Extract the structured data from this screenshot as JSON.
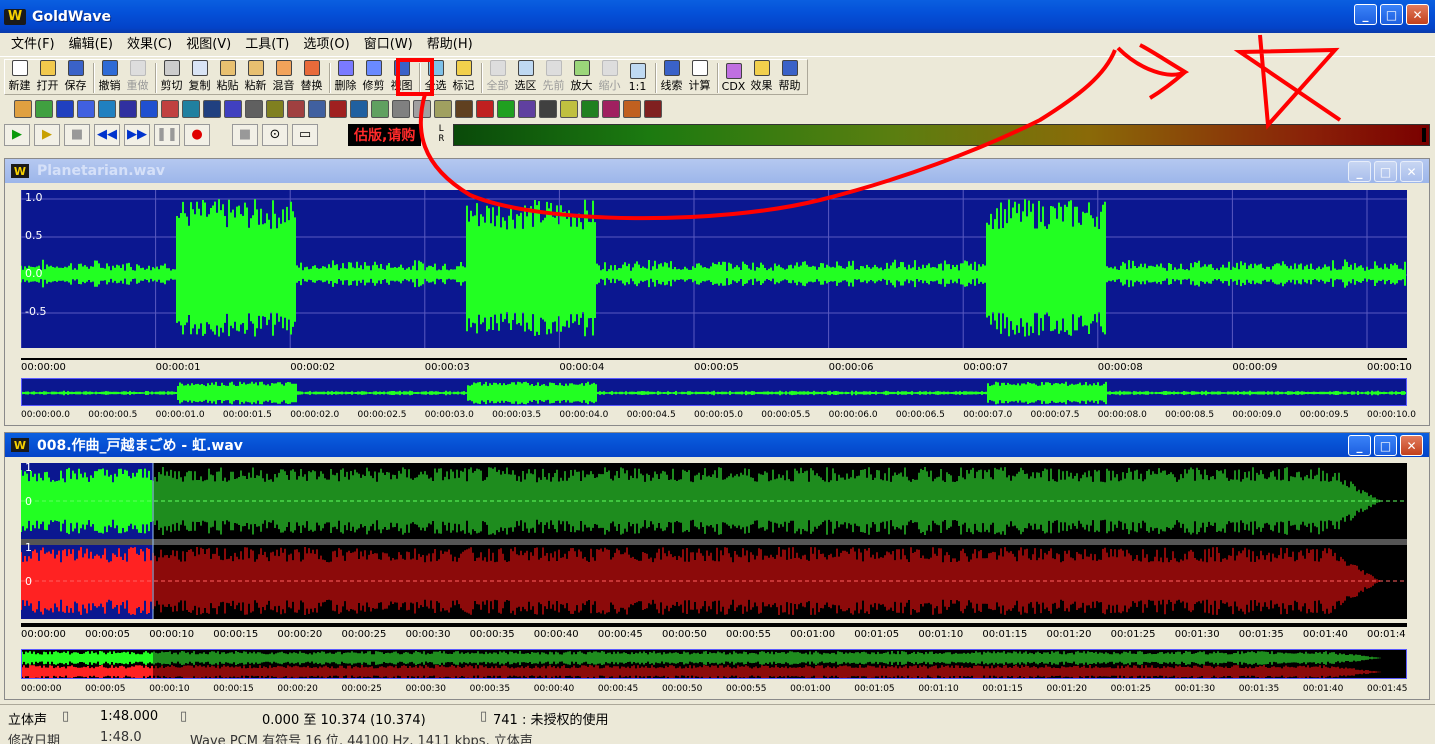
{
  "app": {
    "title": "GoldWave",
    "logo": "W"
  },
  "menu": [
    "文件(F)",
    "编辑(E)",
    "效果(C)",
    "视图(V)",
    "工具(T)",
    "选项(O)",
    "窗口(W)",
    "帮助(H)"
  ],
  "toolbar": [
    {
      "label": "新建",
      "icon": "new-file-icon",
      "color": "#FFFFFF"
    },
    {
      "label": "打开",
      "icon": "open-folder-icon",
      "color": "#F2C94C"
    },
    {
      "label": "保存",
      "icon": "save-disk-icon",
      "color": "#3A62C8"
    },
    {
      "label": "撤销",
      "icon": "undo-icon",
      "color": "#2E6BD6"
    },
    {
      "label": "重做",
      "icon": "redo-icon",
      "color": "#DDDDDD",
      "disabled": true
    },
    {
      "label": "剪切",
      "icon": "scissors-icon",
      "color": "#CCCCCC"
    },
    {
      "label": "复制",
      "icon": "copy-icon",
      "color": "#D9E4F5"
    },
    {
      "label": "粘贴",
      "icon": "paste-icon",
      "color": "#E8C070"
    },
    {
      "label": "粘新",
      "icon": "paste-new-icon",
      "color": "#E8C070"
    },
    {
      "label": "混音",
      "icon": "mix-icon",
      "color": "#F2A35A"
    },
    {
      "label": "替换",
      "icon": "replace-icon",
      "color": "#E86A3A"
    },
    {
      "label": "删除",
      "icon": "delete-icon",
      "color": "#7A7AFF"
    },
    {
      "label": "修剪",
      "icon": "trim-icon",
      "color": "#6A8AFF"
    },
    {
      "label": "视图",
      "icon": "view-icon",
      "color": "#3A62C8"
    },
    {
      "label": "全选",
      "icon": "select-all-icon",
      "color": "#7FC1E8"
    },
    {
      "label": "标记",
      "icon": "marker-icon",
      "color": "#F2D04C"
    },
    {
      "label": "全部",
      "icon": "zoom-all-icon",
      "color": "#DDDDDD",
      "disabled": true
    },
    {
      "label": "选区",
      "icon": "zoom-selection-icon",
      "color": "#BFD9F2"
    },
    {
      "label": "先前",
      "icon": "zoom-previous-icon",
      "color": "#DDDDDD",
      "disabled": true
    },
    {
      "label": "放大",
      "icon": "zoom-in-icon",
      "color": "#9BD67A"
    },
    {
      "label": "缩小",
      "icon": "zoom-out-icon",
      "color": "#DDDDDD",
      "disabled": true
    },
    {
      "label": "1:1",
      "icon": "zoom-1to1-icon",
      "color": "#BFD9F2"
    },
    {
      "label": "线索",
      "icon": "cue-icon",
      "color": "#3A62C8"
    },
    {
      "label": "计算",
      "icon": "calculator-icon",
      "color": "#FFFFFF"
    },
    {
      "label": "CDX",
      "icon": "cd-icon",
      "color": "#C070E0"
    },
    {
      "label": "效果",
      "icon": "effects-icon",
      "color": "#F2D04C"
    },
    {
      "label": "帮助",
      "icon": "help-icon",
      "color": "#3A62C8"
    }
  ],
  "effects_bar_colors": [
    "#E0A040",
    "#40A040",
    "#2040C0",
    "#4060E0",
    "#2080C0",
    "#3030A0",
    "#2050D0",
    "#C04040",
    "#2080A0",
    "#204080",
    "#4040C0",
    "#606060",
    "#808020",
    "#A04040",
    "#4060A0",
    "#A02020",
    "#2060A0",
    "#60A060",
    "#808080",
    "#A0A0A0",
    "#A0A060",
    "#604020",
    "#C02020",
    "#20A020",
    "#6040A0",
    "#404040",
    "#C0C040",
    "#208020",
    "#A02060",
    "#C06020",
    "#802020"
  ],
  "transport": {
    "notice": "估版,请购",
    "meter_labels": "L R"
  },
  "doc1": {
    "title": "Planetarian.wav",
    "logo": "W",
    "amp_labels": [
      "1.0",
      "0.5",
      "0.0",
      "-0.5"
    ],
    "ruler": [
      "00:00:00",
      "00:00:01",
      "00:00:02",
      "00:00:03",
      "00:00:04",
      "00:00:05",
      "00:00:06",
      "00:00:07",
      "00:00:08",
      "00:00:09",
      "00:00:10"
    ],
    "mini_ruler": [
      "00:00:00.0",
      "00:00:00.5",
      "00:00:01.0",
      "00:00:01.5",
      "00:00:02.0",
      "00:00:02.5",
      "00:00:03.0",
      "00:00:03.5",
      "00:00:04.0",
      "00:00:04.5",
      "00:00:05.0",
      "00:00:05.5",
      "00:00:06.0",
      "00:00:06.5",
      "00:00:07.0",
      "00:00:07.5",
      "00:00:08.0",
      "00:00:08.5",
      "00:00:09.0",
      "00:00:09.5",
      "00:00:10.0"
    ],
    "wave_color": "#22FF22",
    "bg_color": "#0B1790"
  },
  "doc2": {
    "title": "008.作曲_戸越まごめ - 虹.wav",
    "logo": "W",
    "amp_labels": [
      "1",
      "0",
      "1",
      "0"
    ],
    "ruler": [
      "00:00:00",
      "00:00:05",
      "00:00:10",
      "00:00:15",
      "00:00:20",
      "00:00:25",
      "00:00:30",
      "00:00:35",
      "00:00:40",
      "00:00:45",
      "00:00:50",
      "00:00:55",
      "00:01:00",
      "00:01:05",
      "00:01:10",
      "00:01:15",
      "00:01:20",
      "00:01:25",
      "00:01:30",
      "00:01:35",
      "00:01:40",
      "00:01:4"
    ],
    "mini_ruler": [
      "00:00:00",
      "00:00:05",
      "00:00:10",
      "00:00:15",
      "00:00:20",
      "00:00:25",
      "00:00:30",
      "00:00:35",
      "00:00:40",
      "00:00:45",
      "00:00:50",
      "00:00:55",
      "00:01:00",
      "00:01:05",
      "00:01:10",
      "00:01:15",
      "00:01:20",
      "00:01:25",
      "00:01:30",
      "00:01:35",
      "00:01:40",
      "00:01:45"
    ],
    "left_color": "#1E8C1E",
    "right_color": "#8C0A0A",
    "selection_left_color": "#22FF22",
    "selection_right_color": "#FF2222"
  },
  "status": {
    "channels": "立体声",
    "length": "1:48.000",
    "selection": "0.000 至 10.374 (10.374)",
    "license": "741 : 未授权的使用",
    "row2_a": "修改日期",
    "row2_b": "1:48.0",
    "row2_c": "Wave PCM 有符号 16 位, 44100 Hz, 1411 kbps, 立体声"
  },
  "annotation": {
    "stroke_color": "#FF0000"
  }
}
